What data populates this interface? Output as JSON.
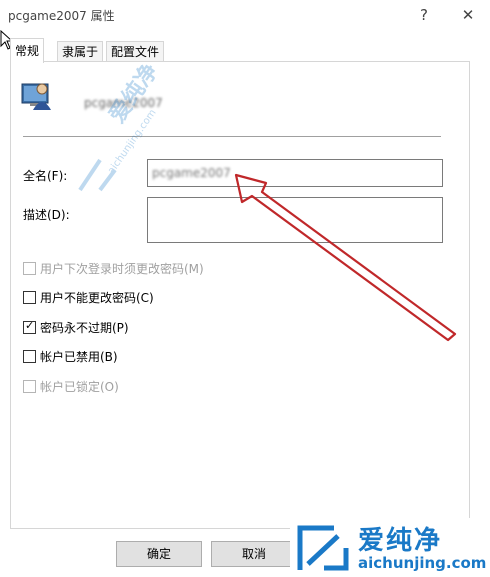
{
  "window": {
    "title": "pcgame2007 属性",
    "help_glyph": "?",
    "close_glyph": "✕"
  },
  "tabs": [
    {
      "label": "常规",
      "active": true
    },
    {
      "label": "隶属于",
      "active": false
    },
    {
      "label": "配置文件",
      "active": false
    }
  ],
  "general": {
    "username": "pcgame2007",
    "fullname_label": "全名(F):",
    "fullname_value": "pcgame2007",
    "description_label": "描述(D):",
    "description_value": "",
    "options": [
      {
        "label": "用户下次登录时须更改密码(M)",
        "checked": false,
        "enabled": false
      },
      {
        "label": "用户不能更改密码(C)",
        "checked": false,
        "enabled": true
      },
      {
        "label": "密码永不过期(P)",
        "checked": true,
        "enabled": true
      },
      {
        "label": "帐户已禁用(B)",
        "checked": false,
        "enabled": true
      },
      {
        "label": "帐户已锁定(O)",
        "checked": false,
        "enabled": false
      }
    ]
  },
  "footer": {
    "ok_label": "确定",
    "cancel_label": "取消"
  },
  "watermark": {
    "brand": "爱纯净",
    "url": "aichunjing.com",
    "center_brand": "爱纯净",
    "center_url": "aichunjing.com",
    "color": "#1a79c7"
  },
  "annotation": {
    "arrow_color": "#c0282a"
  },
  "icons": {
    "user": "user-monitor-icon",
    "cursor": "mouse-pointer-icon"
  }
}
